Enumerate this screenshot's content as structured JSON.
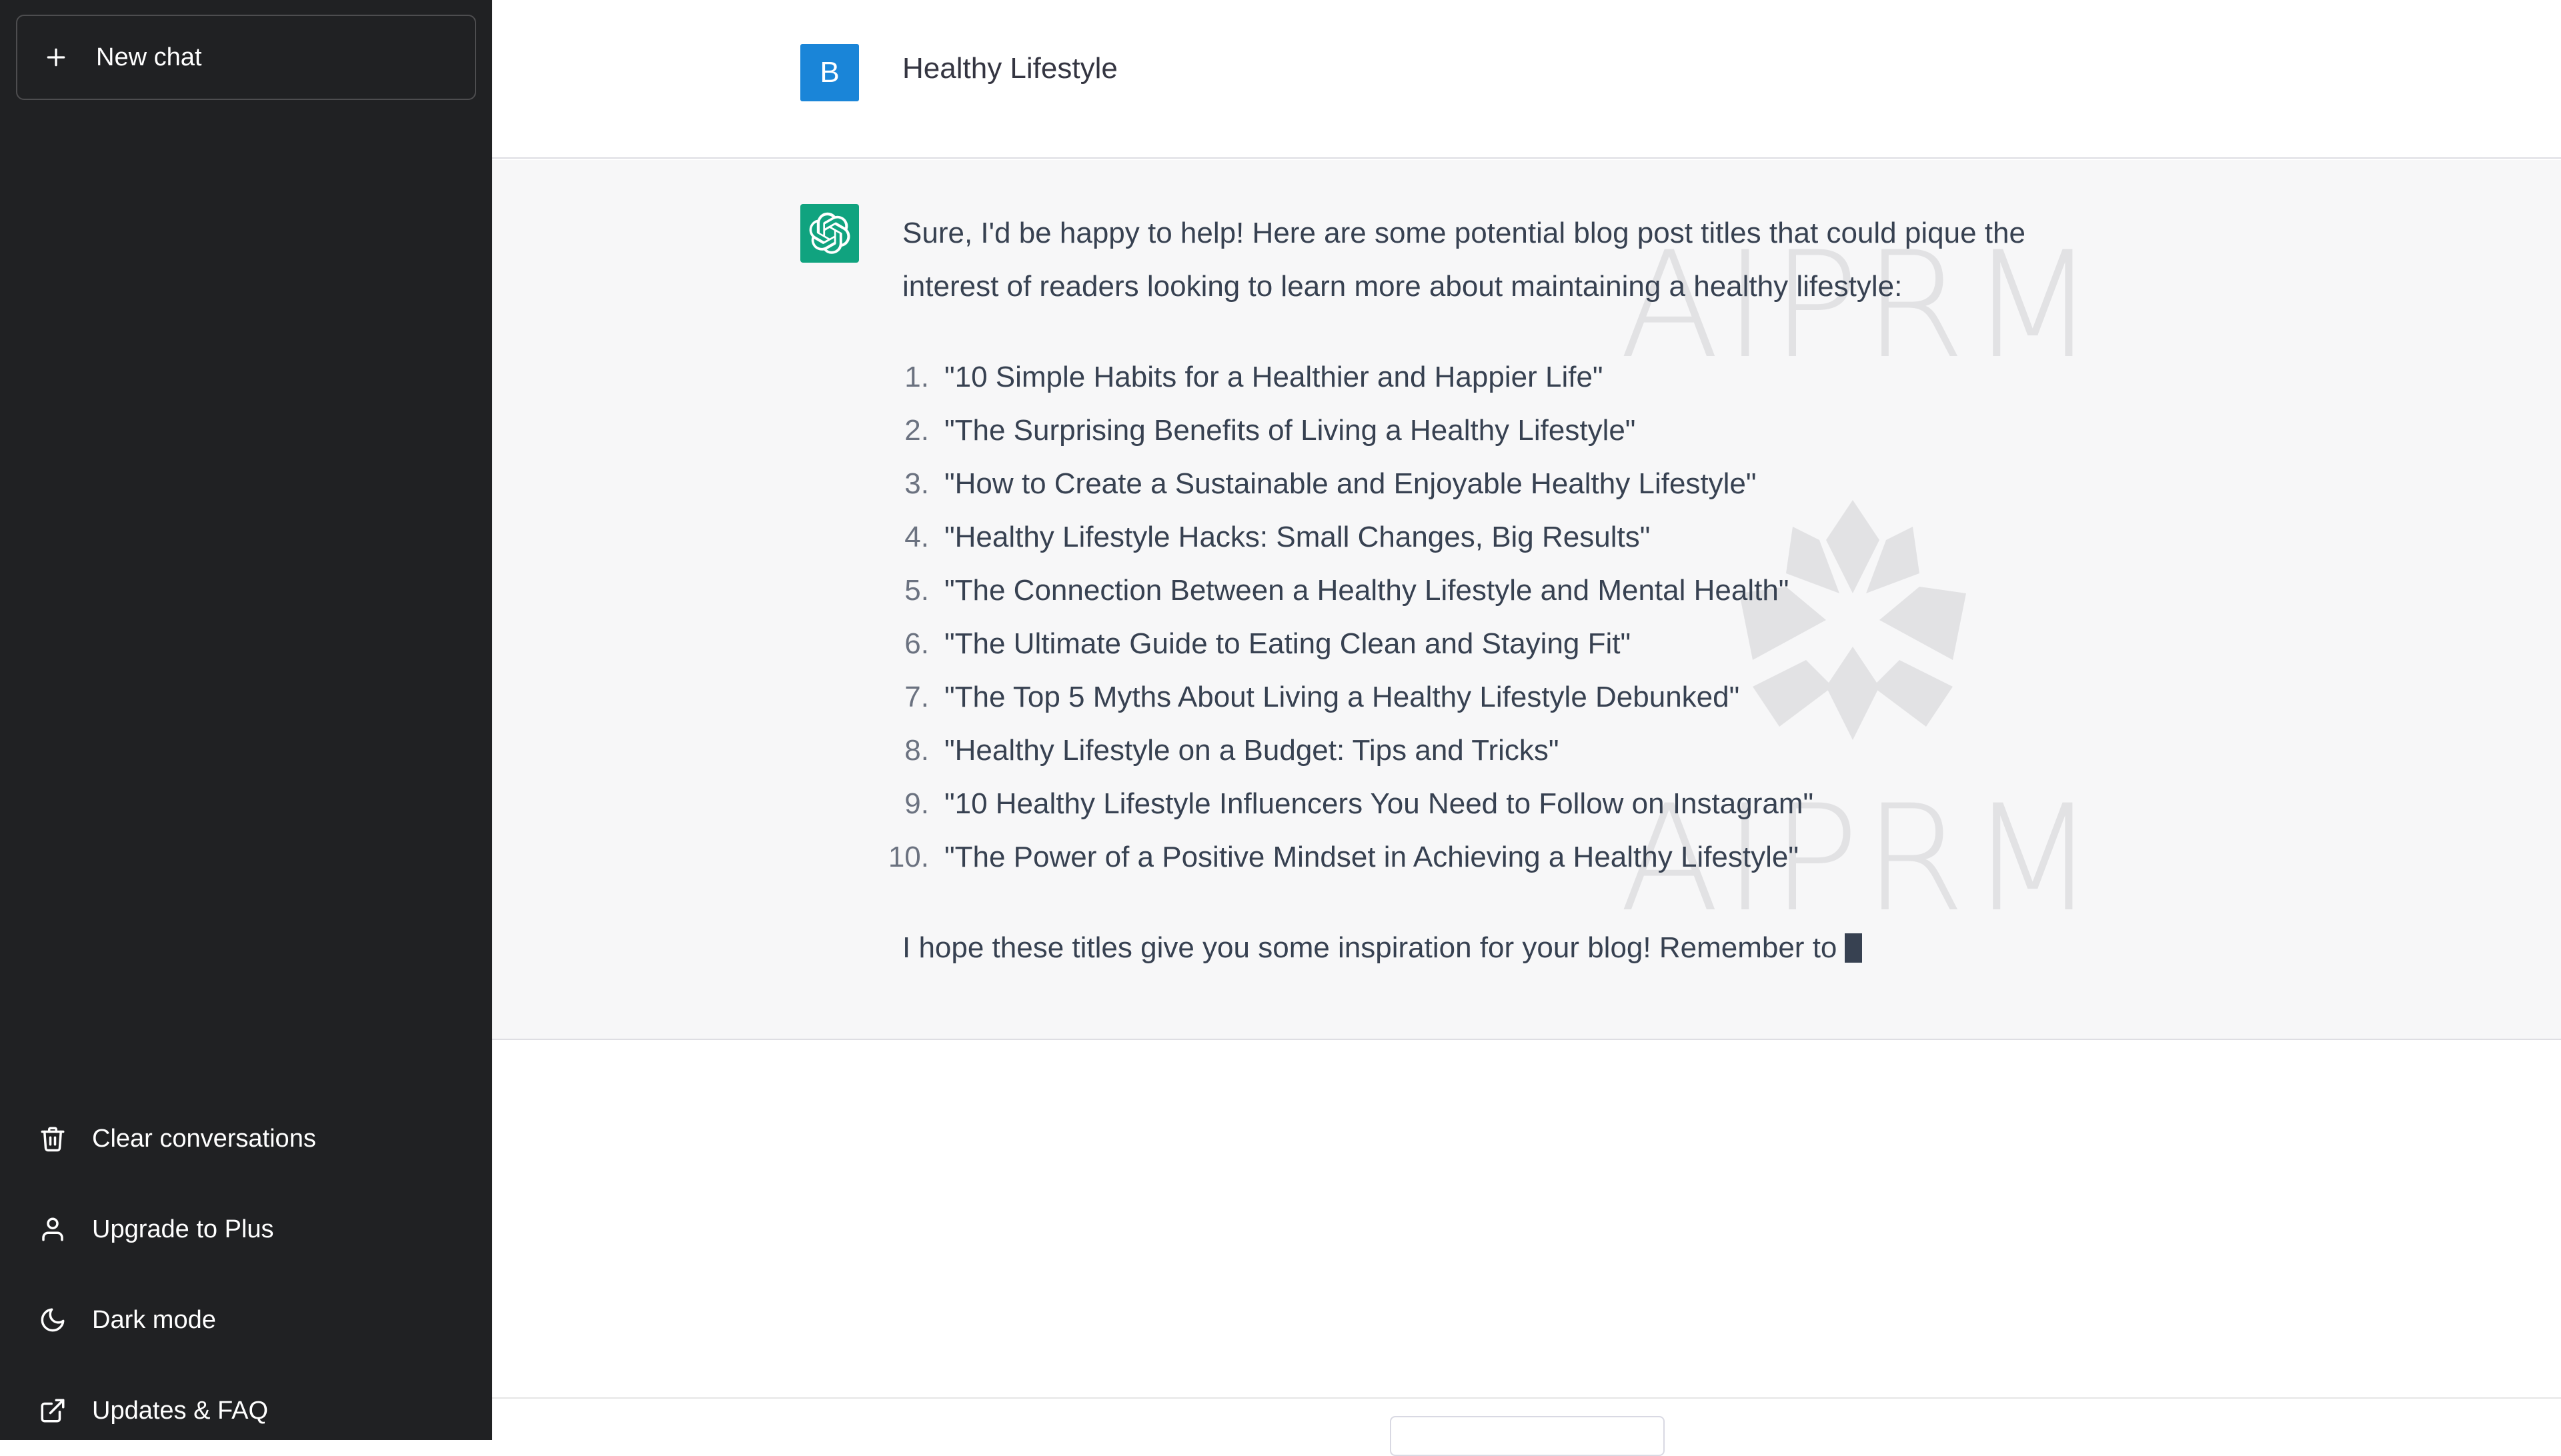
{
  "sidebar": {
    "new_chat": {
      "label": "New chat",
      "icon": "plus-icon"
    },
    "items": [
      {
        "label": "Clear conversations",
        "icon": "trash-icon"
      },
      {
        "label": "Upgrade to Plus",
        "icon": "user-icon"
      },
      {
        "label": "Dark mode",
        "icon": "moon-icon"
      },
      {
        "label": "Updates & FAQ",
        "icon": "external-link-icon"
      }
    ]
  },
  "conversation": {
    "user": {
      "avatar_letter": "B",
      "message": "Healthy Lifestyle"
    },
    "assistant": {
      "intro": "Sure, I'd be happy to help! Here are some potential blog post titles that could pique the interest of readers looking to learn more about maintaining a healthy lifestyle:",
      "list": [
        {
          "num": "1.",
          "text": "\"10 Simple Habits for a Healthier and Happier Life\""
        },
        {
          "num": "2.",
          "text": "\"The Surprising Benefits of Living a Healthy Lifestyle\""
        },
        {
          "num": "3.",
          "text": "\"How to Create a Sustainable and Enjoyable Healthy Lifestyle\""
        },
        {
          "num": "4.",
          "text": "\"Healthy Lifestyle Hacks: Small Changes, Big Results\""
        },
        {
          "num": "5.",
          "text": "\"The Connection Between a Healthy Lifestyle and Mental Health\""
        },
        {
          "num": "6.",
          "text": "\"The Ultimate Guide to Eating Clean and Staying Fit\""
        },
        {
          "num": "7.",
          "text": "\"The Top 5 Myths About Living a Healthy Lifestyle Debunked\""
        },
        {
          "num": "8.",
          "text": "\"Healthy Lifestyle on a Budget: Tips and Tricks\""
        },
        {
          "num": "9.",
          "text": "\"10 Healthy Lifestyle Influencers You Need to Follow on Instagram\""
        },
        {
          "num": "10.",
          "text": "\"The Power of a Positive Mindset in Achieving a Healthy Lifestyle\""
        }
      ],
      "outro": "I hope these titles give you some inspiration for your blog! Remember to"
    }
  },
  "watermark": {
    "text": "AIPRM"
  },
  "colors": {
    "sidebar_bg": "#202123",
    "user_avatar": "#1a85d8",
    "assistant_avatar": "#10a37f",
    "assistant_row_bg": "#f7f7f8"
  }
}
